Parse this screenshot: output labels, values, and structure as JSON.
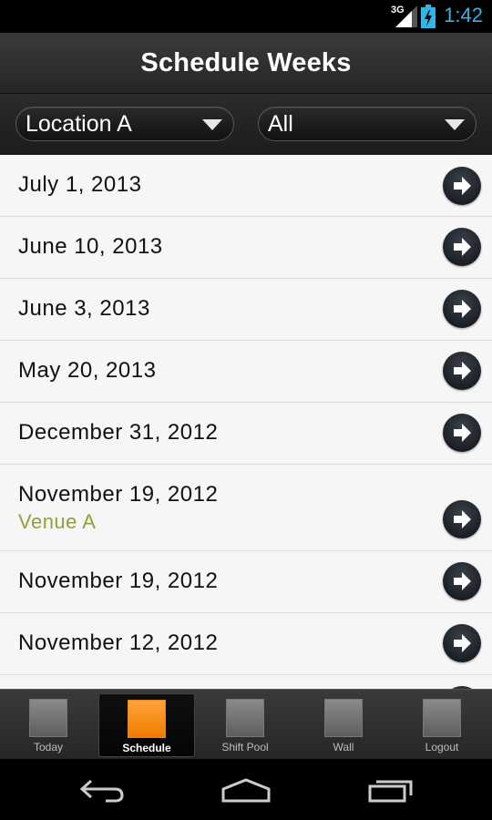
{
  "status_bar": {
    "network": "3G",
    "time": "1:42"
  },
  "action_bar": {
    "title": "Schedule Weeks"
  },
  "filters": {
    "location": {
      "value": "Location A"
    },
    "type": {
      "value": "All"
    }
  },
  "weeks": [
    {
      "date": "July 1, 2013"
    },
    {
      "date": "June 10, 2013"
    },
    {
      "date": "June 3, 2013"
    },
    {
      "date": "May 20, 2013"
    },
    {
      "date": "December 31, 2012"
    },
    {
      "date": "November 19, 2012",
      "venue": "Venue A"
    },
    {
      "date": "November 19, 2012"
    },
    {
      "date": "November 12, 2012"
    }
  ],
  "tabs": [
    {
      "label": "Today",
      "active": false
    },
    {
      "label": "Schedule",
      "active": true
    },
    {
      "label": "Shift Pool",
      "active": false
    },
    {
      "label": "Wall",
      "active": false
    },
    {
      "label": "Logout",
      "active": false
    }
  ],
  "nav": {
    "back_icon": "back-arrow-icon",
    "home_icon": "home-icon",
    "recents_icon": "recent-apps-icon"
  },
  "colors": {
    "accent": "#33b5e5",
    "venue": "#8aa33a",
    "active_tab": "#f7921e"
  }
}
